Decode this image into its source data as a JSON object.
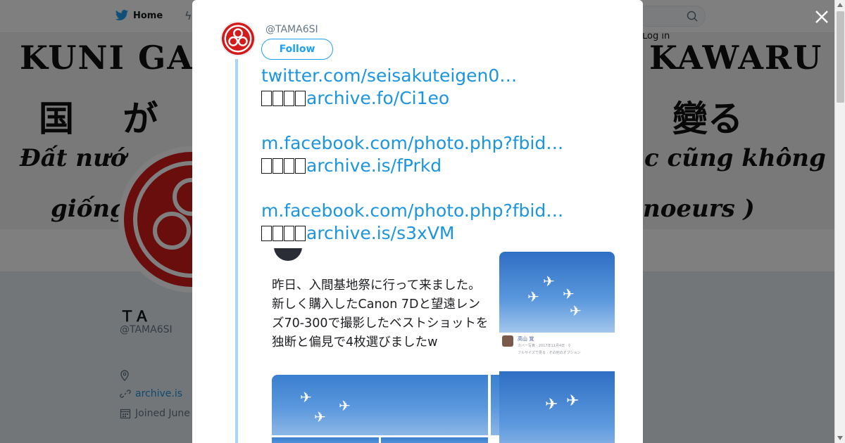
{
  "nav": {
    "home_label": "Home",
    "login_label": "Log in"
  },
  "banner": {
    "line1_left": "KUNI GA K",
    "line1_right": "KAWARU",
    "line2_left": "国 が",
    "line2_right": "變る",
    "line3_left": "Đất nướ",
    "line3_right": "c cũng không",
    "line4_left": "giống",
    "line4_right": "noeurs )"
  },
  "profile": {
    "name": "ＴＡ",
    "handle": "@TAMA6SI",
    "website": "archive.is",
    "joined": "Joined June"
  },
  "modal": {
    "handle": "@TAMA6SI",
    "follow_label": "Follow",
    "tweet": {
      "link1": "twitter.com/seisakuteigen0…",
      "archive1": "archive.fo/Ci1eo",
      "link2": "m.facebook.com/photo.php?fbid…",
      "archive2": "archive.is/fPrkd",
      "link3": "m.facebook.com/photo.php?fbid…",
      "archive3": "archive.is/s3xVM"
    },
    "media": {
      "post_text": "昨日、入間基地祭に行って来ました。\n新しく購入したCanon 7Dと望遠レンズ70-300で撮影したベストショットを独断と偏見で4枚選びましたw",
      "fb_name": "高山 覚",
      "fb_sub": "カバー写真 · 2017年11月4日 · ⚲",
      "fb_options": "フルサイズで見る · その他のオプション"
    }
  },
  "colors": {
    "accent": "#1da1f2",
    "link": "#1b95e0",
    "thread_line": "#a8d7f5",
    "overlay": "rgba(0,0,0,0.5)"
  },
  "icons": [
    "twitter-bird-icon",
    "lightning-icon",
    "search-icon",
    "close-icon",
    "chevron-down-icon",
    "location-icon",
    "link-icon",
    "calendar-icon"
  ]
}
